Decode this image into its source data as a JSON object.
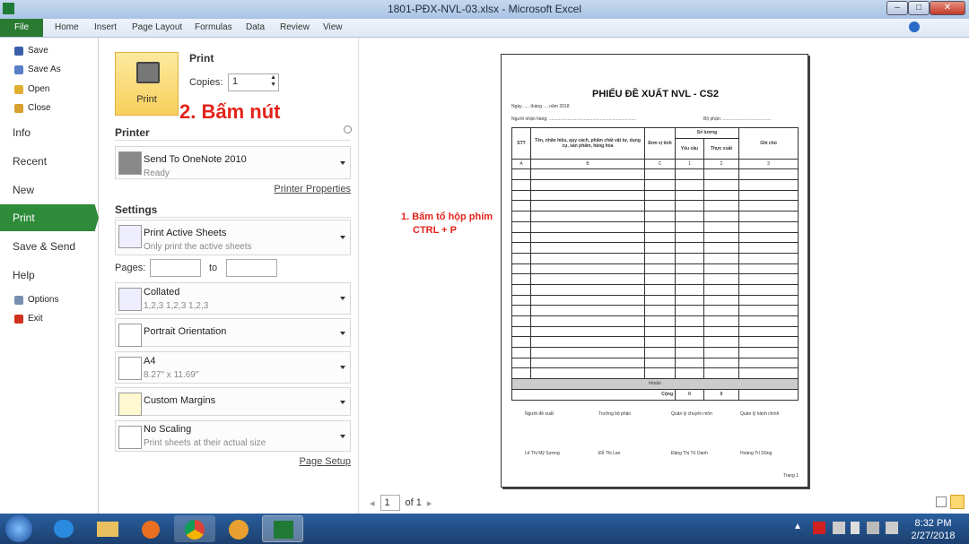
{
  "window": {
    "title": "1801-PĐX-NVL-03.xlsx - Microsoft Excel"
  },
  "ribbon": {
    "file": "File",
    "tabs": [
      "Home",
      "Insert",
      "Page Layout",
      "Formulas",
      "Data",
      "Review",
      "View"
    ]
  },
  "nav": {
    "small_top": [
      {
        "label": "Save",
        "color": "#3a5fa8"
      },
      {
        "label": "Save As",
        "color": "#5a7fc8"
      },
      {
        "label": "Open",
        "color": "#e0b030"
      },
      {
        "label": "Close",
        "color": "#d8a030"
      }
    ],
    "big": [
      "Info",
      "Recent",
      "New",
      "Print",
      "Save & Send",
      "Help"
    ],
    "small_bottom": [
      {
        "label": "Options",
        "color": "#7890b0"
      },
      {
        "label": "Exit",
        "color": "#d03020"
      }
    ],
    "active": "Print"
  },
  "print": {
    "heading": "Print",
    "button": "Print",
    "copies_label": "Copies:",
    "copies_value": "1",
    "annotation": "2. Bấm nút"
  },
  "printer": {
    "heading": "Printer",
    "name": "Send To OneNote 2010",
    "status": "Ready",
    "properties_link": "Printer Properties"
  },
  "settings": {
    "heading": "Settings",
    "sheets": {
      "t1": "Print Active Sheets",
      "t2": "Only print the active sheets"
    },
    "pages_label": "Pages:",
    "to_label": "to",
    "pages_from": "",
    "pages_to": "",
    "collated": {
      "t1": "Collated",
      "t2": "1,2,3    1,2,3    1,2,3"
    },
    "orientation": {
      "t1": "Portrait Orientation"
    },
    "paper": {
      "t1": "A4",
      "t2": "8.27\" x 11.69\""
    },
    "margins": {
      "t1": "Custom Margins"
    },
    "scaling": {
      "t1": "No Scaling",
      "t2": "Print sheets at their actual size"
    },
    "page_setup_link": "Page Setup"
  },
  "preview": {
    "annotation_line1": "1. Bấm tổ hộp phím",
    "annotation_line2": "CTRL + P",
    "page_num": "1",
    "page_of": "of 1",
    "doc": {
      "title": "PHIẾU ĐỀ XUẤT NVL - CS2",
      "date_line": "Ngày ..... tháng .....năm 2018",
      "receiver": "Người nhận hàng: ......................................................................",
      "dept": "Bộ phận: .......................................",
      "headers": {
        "stt": "STT",
        "name": "Tên, nhãn hiệu, quy cách, phẩm chất vật tư, dụng cụ, sản phẩm, hàng hóa",
        "unit": "Đơn vị tính",
        "qty": "Số lượng",
        "req": "Yêu cầu",
        "act": "Thực xuất",
        "note": "Ghi chú"
      },
      "codes": [
        "A",
        "B",
        "C",
        "1",
        "2",
        "3"
      ],
      "band": "khoản",
      "total_label": "Cộng",
      "total_req": "0",
      "total_act": "0",
      "signers_titles": [
        "Người đề xuất",
        "Trưởng bộ phận",
        "Quản lý chuyên môn",
        "Quản lý hành chính"
      ],
      "signers_names": [
        "Lê Thị Mỹ Sương",
        "Đỗ Thị Lan",
        "Đặng Thị Tố Oanh",
        "Hoàng Trí Dũng"
      ],
      "footer": "Trang 1"
    }
  },
  "taskbar": {
    "time": "8:32 PM",
    "date": "2/27/2018"
  }
}
